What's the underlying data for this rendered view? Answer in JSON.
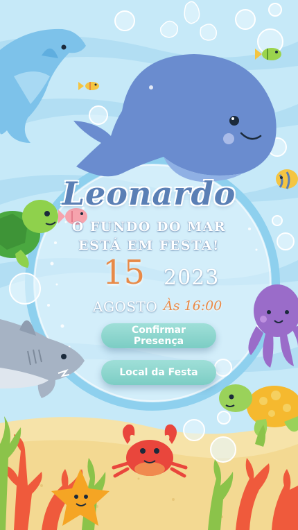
{
  "invitation": {
    "name": "Leonardo",
    "tagline_line1": "O FUNDO DO MAR",
    "tagline_line2": "ESTÁ EM FESTA!",
    "day": "15",
    "year": "2023",
    "month": "AGOSTO",
    "time": "Às 16:00"
  },
  "actions": {
    "confirm_label": "Confirmar Presença",
    "location_label": "Local da Festa"
  },
  "colors": {
    "sky": "#bfe6f6",
    "water_stripe": "#a9d9f0",
    "frame_ring": "#8ed0ee",
    "name_blue": "#5a7fb5",
    "accent_orange": "#e88a48",
    "button_teal": "#7ccdc4",
    "sand": "#f6e3a9"
  },
  "decorations": [
    "dolphin",
    "whale",
    "turtle-left",
    "turtle-right",
    "fish",
    "shark",
    "octopus",
    "crab",
    "starfish",
    "coral",
    "seaweed",
    "bubbles"
  ]
}
